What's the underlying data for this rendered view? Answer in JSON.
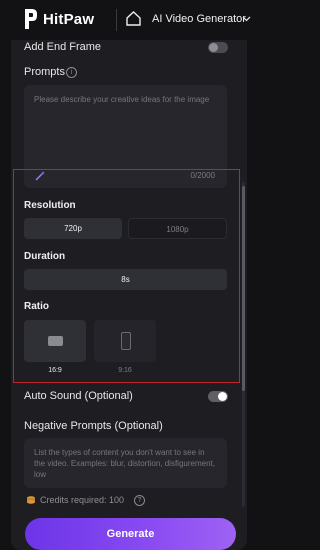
{
  "header": {
    "brand": "HitPaw",
    "mode_label": "AI Video Generator"
  },
  "end_frame": {
    "label": "Add End Frame",
    "enabled": false
  },
  "prompts": {
    "label": "Prompts",
    "placeholder": "Please describe your creative ideas for the image",
    "counter": "0/2000"
  },
  "resolution": {
    "title": "Resolution",
    "options": [
      "720p",
      "1080p"
    ],
    "selected": "720p"
  },
  "duration": {
    "title": "Duration",
    "options": [
      "8s"
    ],
    "selected": "8s"
  },
  "ratio": {
    "title": "Ratio",
    "options": [
      "16:9",
      "9:16"
    ],
    "selected": "16:9"
  },
  "auto_sound": {
    "label": "Auto Sound (Optional)",
    "enabled": true
  },
  "negative_prompts": {
    "label": "Negative Prompts (Optional)",
    "placeholder": "List the types of content you don't want to see in the video. Examples: blur, distortion, disfigurement, low"
  },
  "credits": {
    "text": "Credits required: 100"
  },
  "generate": {
    "label": "Generate"
  },
  "colors": {
    "accent": "#7a3ff0",
    "highlight_border": "#c0232e"
  }
}
